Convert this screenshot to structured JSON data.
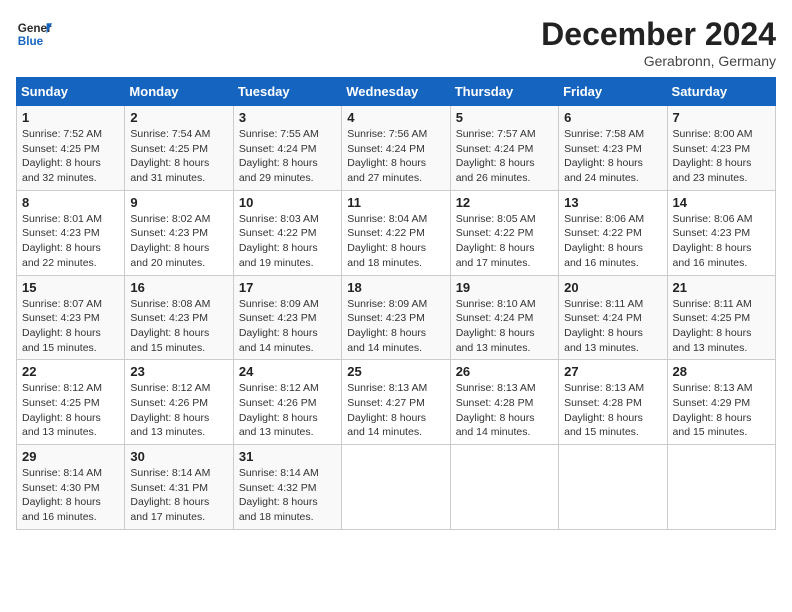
{
  "header": {
    "logo_text_general": "General",
    "logo_text_blue": "Blue",
    "month_title": "December 2024",
    "location": "Gerabronn, Germany"
  },
  "weekdays": [
    "Sunday",
    "Monday",
    "Tuesday",
    "Wednesday",
    "Thursday",
    "Friday",
    "Saturday"
  ],
  "weeks": [
    [
      {
        "day": "1",
        "sunrise": "7:52 AM",
        "sunset": "4:25 PM",
        "daylight": "8 hours and 32 minutes."
      },
      {
        "day": "2",
        "sunrise": "7:54 AM",
        "sunset": "4:25 PM",
        "daylight": "8 hours and 31 minutes."
      },
      {
        "day": "3",
        "sunrise": "7:55 AM",
        "sunset": "4:24 PM",
        "daylight": "8 hours and 29 minutes."
      },
      {
        "day": "4",
        "sunrise": "7:56 AM",
        "sunset": "4:24 PM",
        "daylight": "8 hours and 27 minutes."
      },
      {
        "day": "5",
        "sunrise": "7:57 AM",
        "sunset": "4:24 PM",
        "daylight": "8 hours and 26 minutes."
      },
      {
        "day": "6",
        "sunrise": "7:58 AM",
        "sunset": "4:23 PM",
        "daylight": "8 hours and 24 minutes."
      },
      {
        "day": "7",
        "sunrise": "8:00 AM",
        "sunset": "4:23 PM",
        "daylight": "8 hours and 23 minutes."
      }
    ],
    [
      {
        "day": "8",
        "sunrise": "8:01 AM",
        "sunset": "4:23 PM",
        "daylight": "8 hours and 22 minutes."
      },
      {
        "day": "9",
        "sunrise": "8:02 AM",
        "sunset": "4:23 PM",
        "daylight": "8 hours and 20 minutes."
      },
      {
        "day": "10",
        "sunrise": "8:03 AM",
        "sunset": "4:22 PM",
        "daylight": "8 hours and 19 minutes."
      },
      {
        "day": "11",
        "sunrise": "8:04 AM",
        "sunset": "4:22 PM",
        "daylight": "8 hours and 18 minutes."
      },
      {
        "day": "12",
        "sunrise": "8:05 AM",
        "sunset": "4:22 PM",
        "daylight": "8 hours and 17 minutes."
      },
      {
        "day": "13",
        "sunrise": "8:06 AM",
        "sunset": "4:22 PM",
        "daylight": "8 hours and 16 minutes."
      },
      {
        "day": "14",
        "sunrise": "8:06 AM",
        "sunset": "4:23 PM",
        "daylight": "8 hours and 16 minutes."
      }
    ],
    [
      {
        "day": "15",
        "sunrise": "8:07 AM",
        "sunset": "4:23 PM",
        "daylight": "8 hours and 15 minutes."
      },
      {
        "day": "16",
        "sunrise": "8:08 AM",
        "sunset": "4:23 PM",
        "daylight": "8 hours and 15 minutes."
      },
      {
        "day": "17",
        "sunrise": "8:09 AM",
        "sunset": "4:23 PM",
        "daylight": "8 hours and 14 minutes."
      },
      {
        "day": "18",
        "sunrise": "8:09 AM",
        "sunset": "4:23 PM",
        "daylight": "8 hours and 14 minutes."
      },
      {
        "day": "19",
        "sunrise": "8:10 AM",
        "sunset": "4:24 PM",
        "daylight": "8 hours and 13 minutes."
      },
      {
        "day": "20",
        "sunrise": "8:11 AM",
        "sunset": "4:24 PM",
        "daylight": "8 hours and 13 minutes."
      },
      {
        "day": "21",
        "sunrise": "8:11 AM",
        "sunset": "4:25 PM",
        "daylight": "8 hours and 13 minutes."
      }
    ],
    [
      {
        "day": "22",
        "sunrise": "8:12 AM",
        "sunset": "4:25 PM",
        "daylight": "8 hours and 13 minutes."
      },
      {
        "day": "23",
        "sunrise": "8:12 AM",
        "sunset": "4:26 PM",
        "daylight": "8 hours and 13 minutes."
      },
      {
        "day": "24",
        "sunrise": "8:12 AM",
        "sunset": "4:26 PM",
        "daylight": "8 hours and 13 minutes."
      },
      {
        "day": "25",
        "sunrise": "8:13 AM",
        "sunset": "4:27 PM",
        "daylight": "8 hours and 14 minutes."
      },
      {
        "day": "26",
        "sunrise": "8:13 AM",
        "sunset": "4:28 PM",
        "daylight": "8 hours and 14 minutes."
      },
      {
        "day": "27",
        "sunrise": "8:13 AM",
        "sunset": "4:28 PM",
        "daylight": "8 hours and 15 minutes."
      },
      {
        "day": "28",
        "sunrise": "8:13 AM",
        "sunset": "4:29 PM",
        "daylight": "8 hours and 15 minutes."
      }
    ],
    [
      {
        "day": "29",
        "sunrise": "8:14 AM",
        "sunset": "4:30 PM",
        "daylight": "8 hours and 16 minutes."
      },
      {
        "day": "30",
        "sunrise": "8:14 AM",
        "sunset": "4:31 PM",
        "daylight": "8 hours and 17 minutes."
      },
      {
        "day": "31",
        "sunrise": "8:14 AM",
        "sunset": "4:32 PM",
        "daylight": "8 hours and 18 minutes."
      },
      null,
      null,
      null,
      null
    ]
  ],
  "labels": {
    "sunrise": "Sunrise:",
    "sunset": "Sunset:",
    "daylight": "Daylight:"
  }
}
